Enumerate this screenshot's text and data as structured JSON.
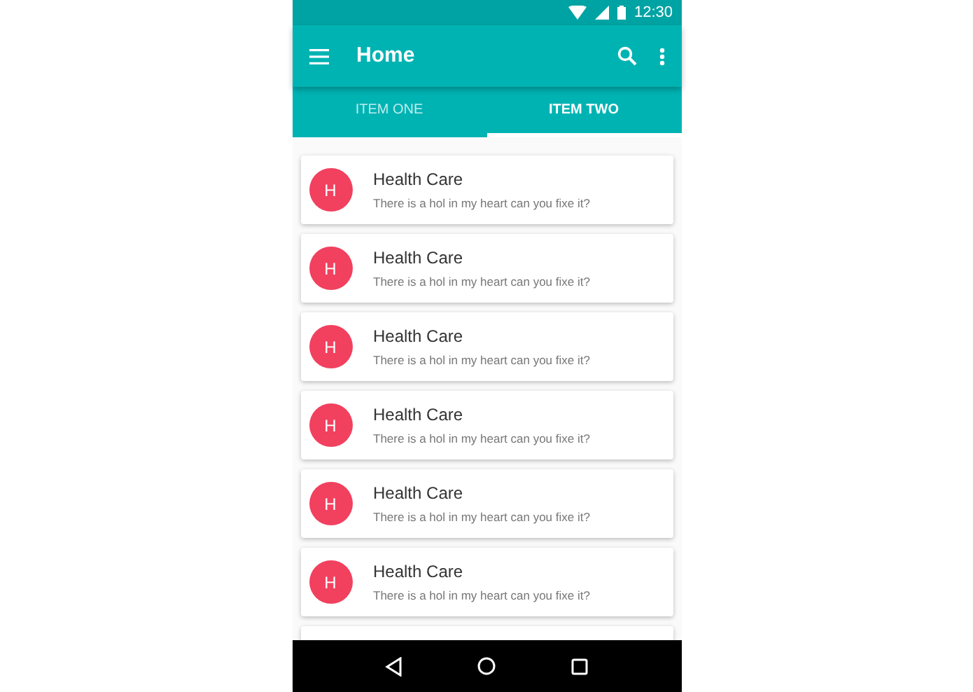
{
  "status_bar": {
    "time": "12:30"
  },
  "toolbar": {
    "title": "Home"
  },
  "tabs": [
    {
      "label": "ITEM ONE",
      "selected": false
    },
    {
      "label": "ITEM TWO",
      "selected": true
    }
  ],
  "cards": [
    {
      "avatar": "H",
      "title": "Health Care",
      "subtitle": "There is a hol in my heart can you fixe it?"
    },
    {
      "avatar": "H",
      "title": "Health Care",
      "subtitle": "There is a hol in my heart can you fixe it?"
    },
    {
      "avatar": "H",
      "title": "Health Care",
      "subtitle": "There is a hol in my heart can you fixe it?"
    },
    {
      "avatar": "H",
      "title": "Health Care",
      "subtitle": "There is a hol in my heart can you fixe it?"
    },
    {
      "avatar": "H",
      "title": "Health Care",
      "subtitle": "There is a hol in my heart can you fixe it?"
    },
    {
      "avatar": "H",
      "title": "Health Care",
      "subtitle": "There is a hol in my heart can you fixe it?"
    }
  ]
}
